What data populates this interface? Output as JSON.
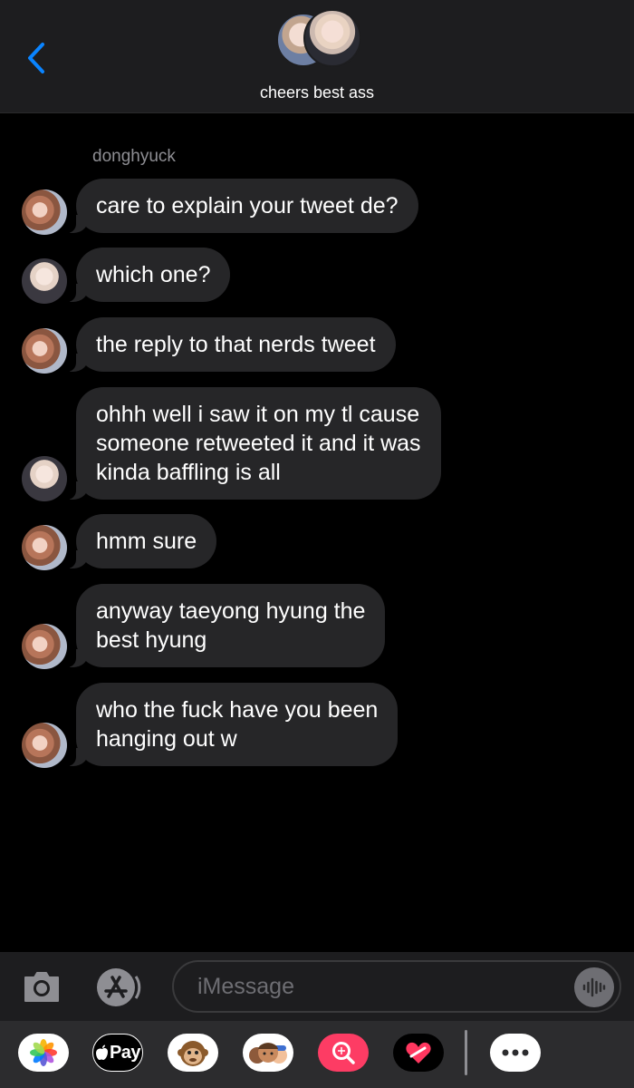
{
  "header": {
    "title": "cheers best ass",
    "back_icon": "chevron-left-icon",
    "accent_color": "#0a84ff"
  },
  "thread": {
    "sender_name": "donghyuck",
    "messages": [
      {
        "sender": "donghyuck",
        "text": "care to explain your tweet de?"
      },
      {
        "sender": "other",
        "text": "which one?"
      },
      {
        "sender": "donghyuck",
        "text": "the reply to that nerds tweet"
      },
      {
        "sender": "other",
        "text": "ohhh well i saw it on my tl cause\nsomeone retweeted it and it was\nkinda baffling is all"
      },
      {
        "sender": "donghyuck",
        "text": "hmm sure"
      },
      {
        "sender": "donghyuck",
        "text": "anyway taeyong hyung the\nbest hyung"
      },
      {
        "sender": "donghyuck",
        "text": "who the fuck have you been\nhanging out w"
      }
    ]
  },
  "composer": {
    "placeholder": "iMessage",
    "camera_icon": "camera-icon",
    "appstore_icon": "app-store-icon",
    "audio_icon": "audio-waveform-icon"
  },
  "drawer": {
    "apps": [
      "photos-icon",
      "apple-pay-icon",
      "animoji-icon",
      "memoji-icon",
      "image-search-icon",
      "digital-touch-icon"
    ],
    "pay_label": "Pay",
    "more_icon": "more-icon"
  }
}
